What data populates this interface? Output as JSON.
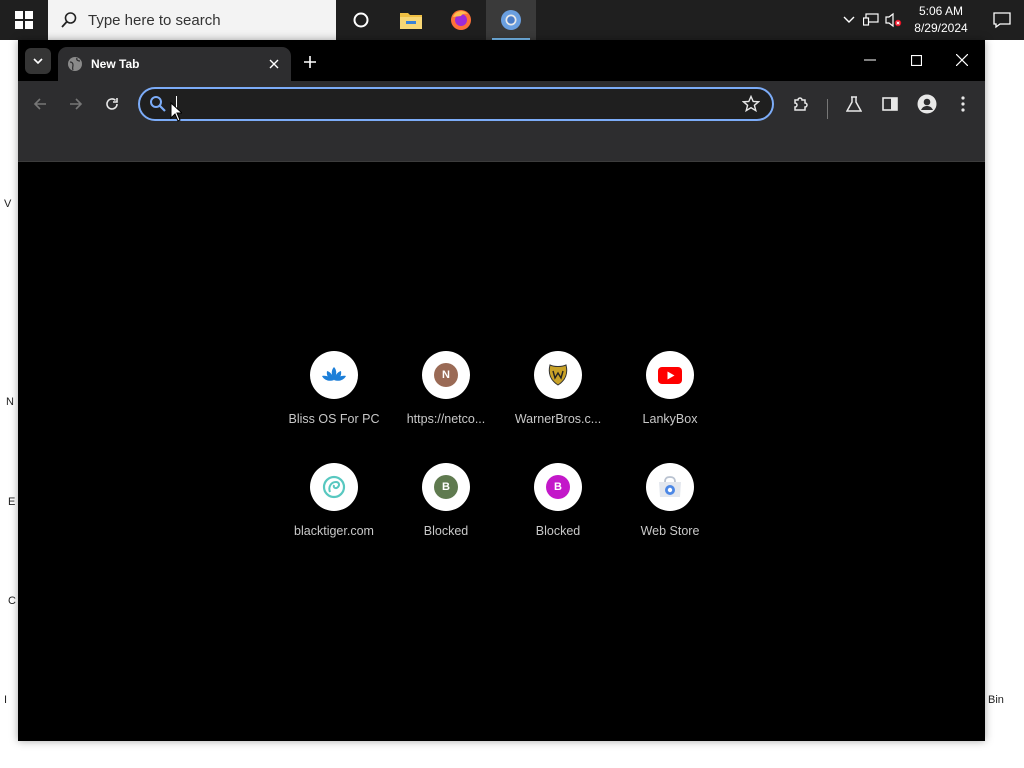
{
  "taskbar": {
    "search_placeholder": "Type here to search",
    "time": "5:06 AM",
    "date": "8/29/2024",
    "apps": [
      {
        "icon": "cortana-icon"
      },
      {
        "icon": "file-explorer-icon"
      },
      {
        "icon": "firefox-icon"
      },
      {
        "icon": "chrome-icon",
        "active": true
      }
    ]
  },
  "browser": {
    "tab": {
      "title": "New Tab"
    },
    "omnibox": {
      "value": "",
      "placeholder": ""
    },
    "colors": {
      "accent": "#7cacf8",
      "toolbar": "#2d2d2f",
      "page_bg": "#000000"
    }
  },
  "shortcuts": [
    {
      "label": "Bliss OS For PC",
      "icon": "lotus-icon"
    },
    {
      "label": "https://netco...",
      "icon": "letter-n-icon",
      "letter": "N",
      "color": "#9a6a55"
    },
    {
      "label": "WarnerBros.c...",
      "icon": "warner-bros-icon"
    },
    {
      "label": "LankyBox",
      "icon": "youtube-icon"
    },
    {
      "label": "blacktiger.com",
      "icon": "blacktiger-icon"
    },
    {
      "label": "Blocked",
      "icon": "letter-b-icon",
      "letter": "B",
      "color": "#5f7a4f"
    },
    {
      "label": "Blocked",
      "icon": "letter-b-icon",
      "letter": "B",
      "color": "#c318c9"
    },
    {
      "label": "Web Store",
      "icon": "chrome-web-store-icon"
    }
  ]
}
